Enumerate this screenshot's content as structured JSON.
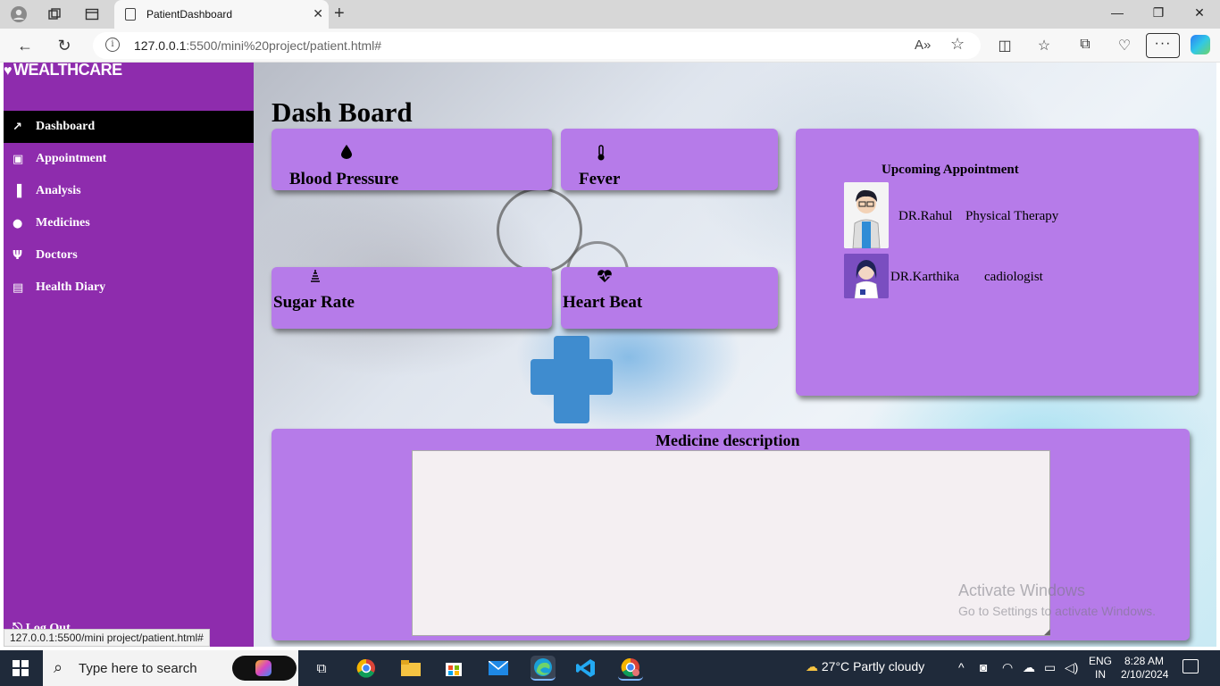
{
  "browser": {
    "tab_title": "PatientDashboard",
    "url_host": "127.0.0.1",
    "url_rest": ":5500/mini%20project/patient.html#",
    "status_url": "127.0.0.1:5500/mini project/patient.html#",
    "read_aloud_label": "A»"
  },
  "sidebar": {
    "brand": "WEALTHCARE",
    "items": [
      {
        "label": "Dashboard",
        "icon": "chart-line-icon",
        "glyph": "↗"
      },
      {
        "label": "Appointment",
        "icon": "calendar-check-icon",
        "glyph": "▣"
      },
      {
        "label": "Analysis",
        "icon": "bar-chart-icon",
        "glyph": "▐"
      },
      {
        "label": "Medicines",
        "icon": "pills-icon",
        "glyph": "●"
      },
      {
        "label": "Doctors",
        "icon": "stethoscope-icon",
        "glyph": "Ψ"
      },
      {
        "label": "Health Diary",
        "icon": "notes-medical-icon",
        "glyph": "▤"
      }
    ],
    "logout": "Log Out"
  },
  "main": {
    "title": "Dash Board",
    "cards": [
      {
        "label": "Blood Pressure",
        "icon": "droplet-icon",
        "glyph": "◆"
      },
      {
        "label": "Fever",
        "icon": "thermometer-icon",
        "glyph": "↕"
      },
      {
        "label": "Sugar Rate",
        "icon": "syringe-icon",
        "glyph": "≡"
      },
      {
        "label": "Heart Beat",
        "icon": "heart-pulse-icon",
        "glyph": "♥"
      }
    ],
    "appointments": {
      "title": "Upcoming Appointment",
      "doctors": [
        {
          "name": "DR.Rahul",
          "specialty": "Physical Therapy"
        },
        {
          "name": "DR.Karthika",
          "specialty": "cadiologist"
        }
      ]
    },
    "medicine": {
      "title": "Medicine description",
      "value": ""
    }
  },
  "watermark": {
    "line1": "Activate Windows",
    "line2": "Go to Settings to activate Windows."
  },
  "taskbar": {
    "search_placeholder": "Type here to search",
    "weather_temp": "27°C",
    "weather_text": "Partly cloudy",
    "lang_top": "ENG",
    "lang_bottom": "IN",
    "time": "8:28 AM",
    "date": "2/10/2024"
  },
  "colors": {
    "sidebar": "#8e2cad",
    "card": "#b67be9",
    "active_menu": "#000000"
  }
}
